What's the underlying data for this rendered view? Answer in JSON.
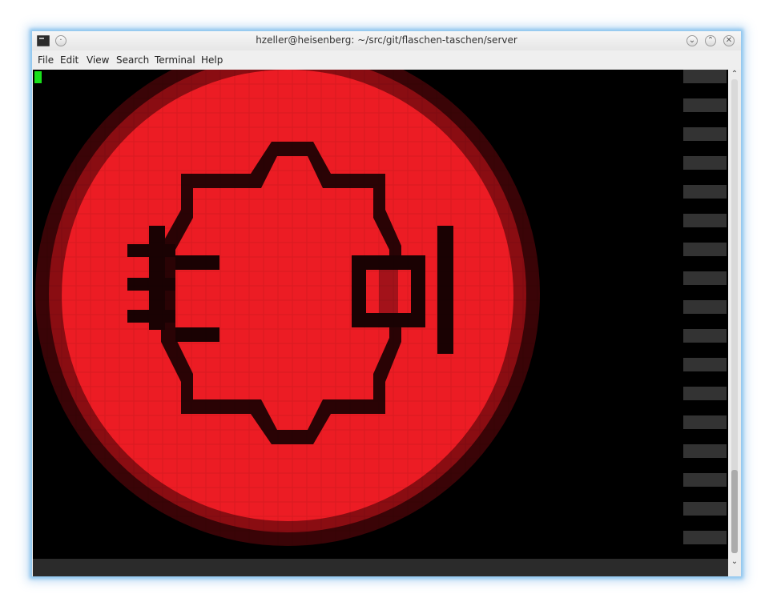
{
  "window": {
    "title": "hzeller@heisenberg: ~/src/git/flaschen-taschen/server"
  },
  "menu": {
    "items": [
      "File",
      "Edit",
      "View",
      "Search",
      "Terminal",
      "Help"
    ]
  },
  "title_buttons": {
    "minimize": "⌄",
    "maximize": "⌃",
    "close": "✕"
  },
  "scrollbar": {
    "up": "⌃",
    "down": "⌄"
  },
  "colors": {
    "cursor": "#19e01c",
    "image_fill": "#ec1c24",
    "image_outline": "#000000",
    "terminal_bg": "#000000"
  },
  "image": {
    "description_icon": "red-circle-pixel-logo"
  }
}
